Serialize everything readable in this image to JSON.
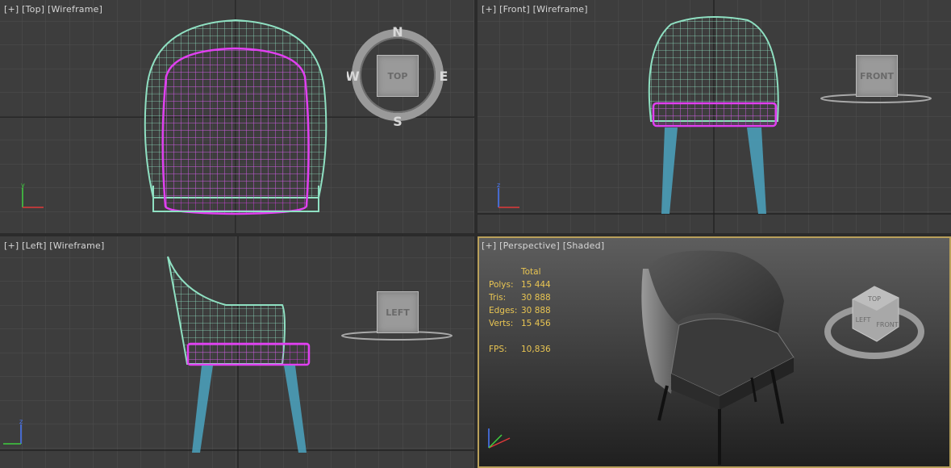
{
  "viewports": {
    "top": {
      "plus": "[+]",
      "view": "[Top]",
      "mode": "[Wireframe]",
      "cube": "TOP",
      "compass": {
        "n": "N",
        "s": "S",
        "e": "E",
        "w": "W"
      }
    },
    "front": {
      "plus": "[+]",
      "view": "[Front]",
      "mode": "[Wireframe]",
      "cube": "FRONT"
    },
    "left": {
      "plus": "[+]",
      "view": "[Left]",
      "mode": "[Wireframe]",
      "cube": "LEFT"
    },
    "perspective": {
      "plus": "[+]",
      "view": "[Perspective]",
      "mode": "[Shaded]",
      "cube_top": "TOP",
      "cube_front": "FRONT",
      "cube_left": "LEFT"
    }
  },
  "stats": {
    "header": "Total",
    "polys_label": "Polys:",
    "polys": "15 444",
    "tris_label": "Tris:",
    "tris": "30 888",
    "edges_label": "Edges:",
    "edges": "30 888",
    "verts_label": "Verts:",
    "verts": "15 456",
    "fps_label": "FPS:",
    "fps": "10,836"
  },
  "colors": {
    "viewport_bg": "#3d3d3d",
    "grid": "#4e4e4e",
    "grid_axis": "#1f1f1f",
    "mesh_body": "#8fe0c2",
    "mesh_seat": "#e040f0",
    "mesh_legs": "#4ba3c0",
    "active_border": "#b9a05a",
    "stats_text": "#e9c552"
  }
}
